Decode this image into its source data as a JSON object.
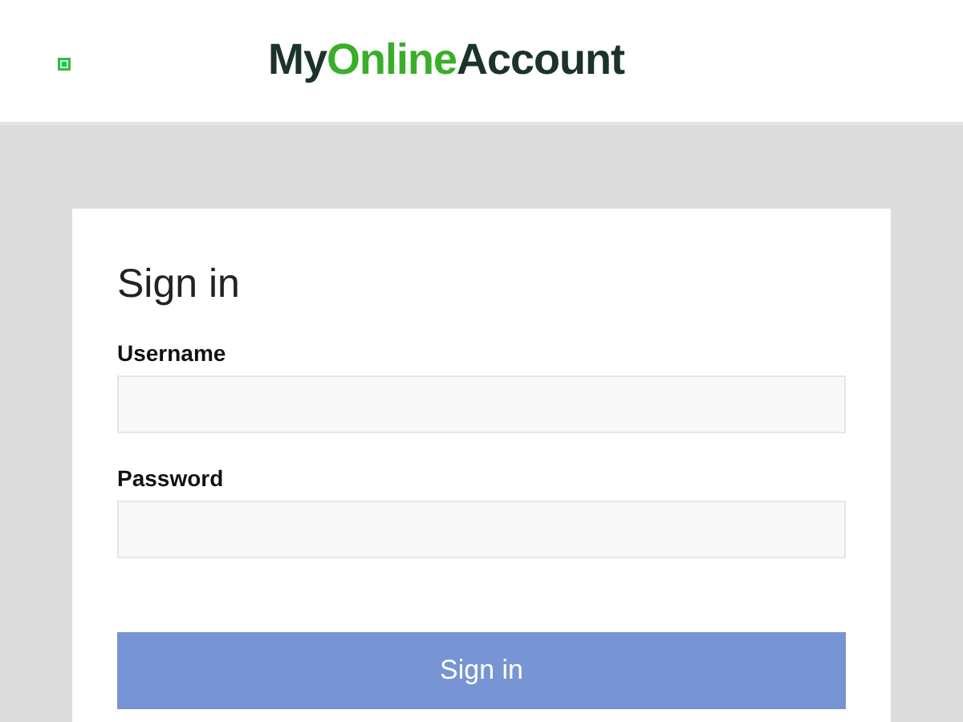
{
  "header": {
    "logo_parts": [
      {
        "text": "My",
        "color": "#1b3329"
      },
      {
        "text": "Online",
        "color": "#3aae2a"
      },
      {
        "text": "Account",
        "color": "#1b3329"
      }
    ]
  },
  "form": {
    "title": "Sign in",
    "fields": [
      {
        "label": "Username"
      },
      {
        "label": "Password"
      }
    ],
    "submit": "Sign in"
  }
}
